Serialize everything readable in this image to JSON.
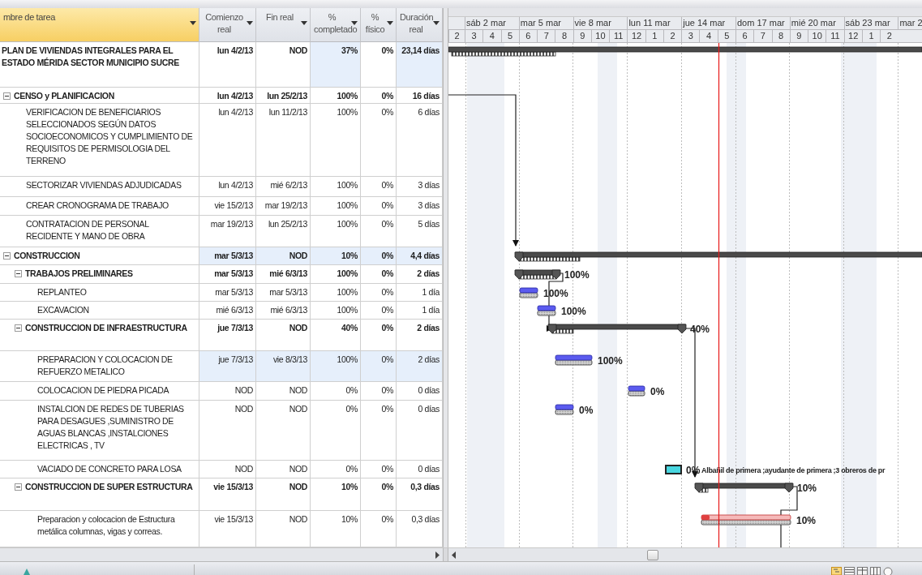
{
  "table": {
    "task_column": {
      "label": "mbre de tarea",
      "selected": true
    },
    "columns": [
      {
        "label": "Comienzo real",
        "selected": false
      },
      {
        "label": "Fin real",
        "selected": false
      },
      {
        "label": "% completado",
        "selected": false
      },
      {
        "label": "% físico",
        "selected": false
      },
      {
        "label": "Duración real",
        "selected": false
      }
    ],
    "rows": [
      {
        "name": "PLAN DE VIVIENDAS INTEGRALES PARA EL ESTADO MÉRIDA SECTOR MUNICIPIO SUCRE",
        "kind": "project",
        "cells": [
          {
            "text": "lun 4/2/13",
            "shaded": false
          },
          {
            "text": "NOD",
            "shaded": false
          },
          {
            "text": "37%",
            "shaded": true
          },
          {
            "text": "0%",
            "shaded": false
          },
          {
            "text": "23,14 días",
            "shaded": true
          }
        ],
        "bar": {
          "kind": "summary"
        },
        "children": [
          {
            "name": "CENSO y  PLANIFICACION",
            "kind": "summary",
            "expanded": true,
            "cells": [
              {
                "text": "lun 4/2/13",
                "shaded": false
              },
              {
                "text": "lun 25/2/13",
                "shaded": false
              },
              {
                "text": "100%",
                "shaded": false
              },
              {
                "text": "0%",
                "shaded": false
              },
              {
                "text": "16 días",
                "shaded": false
              }
            ],
            "children": [
              {
                "name": "VERIFICACION DE BENEFICIARIOS SELECCIONADOS SEGÚN DATOS SOCIOECONOMICOS Y CUMPLIMIENTO DE REQUISITOS DE PERMISOLOGIA DEL TERRENO",
                "kind": "task",
                "cells": [
                  {
                    "text": "lun 4/2/13",
                    "shaded": false
                  },
                  {
                    "text": "lun 11/2/13",
                    "shaded": false
                  },
                  {
                    "text": "100%",
                    "shaded": false
                  },
                  {
                    "text": "0%",
                    "shaded": false
                  },
                  {
                    "text": "6 días",
                    "shaded": false
                  }
                ]
              },
              {
                "name": "SECTORIZAR VIVIENDAS ADJUDICADAS",
                "kind": "task",
                "cells": [
                  {
                    "text": "lun 4/2/13",
                    "shaded": false
                  },
                  {
                    "text": "mié 6/2/13",
                    "shaded": false
                  },
                  {
                    "text": "100%",
                    "shaded": false
                  },
                  {
                    "text": "0%",
                    "shaded": false
                  },
                  {
                    "text": "3 días",
                    "shaded": false
                  }
                ]
              },
              {
                "name": "CREAR CRONOGRAMA DE TRABAJO",
                "kind": "task",
                "cells": [
                  {
                    "text": "vie 15/2/13",
                    "shaded": false
                  },
                  {
                    "text": "mar 19/2/13",
                    "shaded": false
                  },
                  {
                    "text": "100%",
                    "shaded": false
                  },
                  {
                    "text": "0%",
                    "shaded": false
                  },
                  {
                    "text": "3 días",
                    "shaded": false
                  }
                ]
              },
              {
                "name": "CONTRATACION DE PERSONAL RECIDENTE Y MANO DE OBRA",
                "kind": "task",
                "cells": [
                  {
                    "text": "mar 19/2/13",
                    "shaded": false
                  },
                  {
                    "text": "lun 25/2/13",
                    "shaded": false
                  },
                  {
                    "text": "100%",
                    "shaded": false
                  },
                  {
                    "text": "0%",
                    "shaded": false
                  },
                  {
                    "text": "5 días",
                    "shaded": false
                  }
                ]
              }
            ]
          },
          {
            "name": "CONSTRUCCION",
            "kind": "summary",
            "expanded": true,
            "cells": [
              {
                "text": "mar 5/3/13",
                "shaded": true
              },
              {
                "text": "NOD",
                "shaded": true
              },
              {
                "text": "10%",
                "shaded": true
              },
              {
                "text": "0%",
                "shaded": true
              },
              {
                "text": "4,4 días",
                "shaded": true
              }
            ],
            "bar": {
              "kind": "summary"
            },
            "children": [
              {
                "name": "TRABAJOS PRELIMINARES",
                "kind": "summary",
                "expanded": true,
                "cells": [
                  {
                    "text": "mar 5/3/13",
                    "shaded": false
                  },
                  {
                    "text": "mié 6/3/13",
                    "shaded": false
                  },
                  {
                    "text": "100%",
                    "shaded": false
                  },
                  {
                    "text": "0%",
                    "shaded": false
                  },
                  {
                    "text": "2 días",
                    "shaded": false
                  }
                ],
                "bar": {
                  "kind": "summary",
                  "label": "100%"
                },
                "children": [
                  {
                    "name": "REPLANTEO",
                    "kind": "task",
                    "cells": [
                      {
                        "text": "mar 5/3/13",
                        "shaded": false
                      },
                      {
                        "text": "mar 5/3/13",
                        "shaded": false
                      },
                      {
                        "text": "100%",
                        "shaded": false
                      },
                      {
                        "text": "0%",
                        "shaded": false
                      },
                      {
                        "text": "1 día",
                        "shaded": false
                      }
                    ],
                    "bar": {
                      "kind": "task",
                      "label": "100%"
                    }
                  },
                  {
                    "name": "EXCAVACION",
                    "kind": "task",
                    "cells": [
                      {
                        "text": "mié 6/3/13",
                        "shaded": false
                      },
                      {
                        "text": "mié 6/3/13",
                        "shaded": false
                      },
                      {
                        "text": "100%",
                        "shaded": false
                      },
                      {
                        "text": "0%",
                        "shaded": false
                      },
                      {
                        "text": "1 día",
                        "shaded": false
                      }
                    ],
                    "bar": {
                      "kind": "task",
                      "label": "100%"
                    }
                  }
                ]
              },
              {
                "name": "CONSTRUCCION DE INFRAESTRUCTURA",
                "kind": "summary",
                "expanded": true,
                "cells": [
                  {
                    "text": "jue 7/3/13",
                    "shaded": false
                  },
                  {
                    "text": "NOD",
                    "shaded": false
                  },
                  {
                    "text": "40%",
                    "shaded": false
                  },
                  {
                    "text": "0%",
                    "shaded": false
                  },
                  {
                    "text": "2 días",
                    "shaded": false
                  }
                ],
                "bar": {
                  "kind": "summary",
                  "label": "40%"
                },
                "children": [
                  {
                    "name": "PREPARACION Y COLOCACION DE REFUERZO METALICO",
                    "kind": "task",
                    "cells": [
                      {
                        "text": "jue 7/3/13",
                        "shaded": true
                      },
                      {
                        "text": "vie 8/3/13",
                        "shaded": true
                      },
                      {
                        "text": "100%",
                        "shaded": true
                      },
                      {
                        "text": "0%",
                        "shaded": true
                      },
                      {
                        "text": "2 días",
                        "shaded": true
                      }
                    ],
                    "bar": {
                      "kind": "task",
                      "label": "100%"
                    }
                  },
                  {
                    "name": "COLOCACION DE PIEDRA PICADA",
                    "kind": "task",
                    "cells": [
                      {
                        "text": "NOD",
                        "shaded": false
                      },
                      {
                        "text": "NOD",
                        "shaded": false
                      },
                      {
                        "text": "0%",
                        "shaded": false
                      },
                      {
                        "text": "0%",
                        "shaded": false
                      },
                      {
                        "text": "0 días",
                        "shaded": false
                      }
                    ],
                    "bar": {
                      "kind": "task",
                      "label": "0%"
                    }
                  },
                  {
                    "name": "INSTALCION DE REDES DE TUBERIAS PARA DESAGUES ,SUMINISTRO DE AGUAS BLANCAS ,INSTALCIONES ELECTRICAS , TV",
                    "kind": "task",
                    "cells": [
                      {
                        "text": "NOD",
                        "shaded": false
                      },
                      {
                        "text": "NOD",
                        "shaded": false
                      },
                      {
                        "text": "0%",
                        "shaded": false
                      },
                      {
                        "text": "0%",
                        "shaded": false
                      },
                      {
                        "text": "0 días",
                        "shaded": false
                      }
                    ],
                    "bar": {
                      "kind": "task",
                      "label": "0%"
                    }
                  },
                  {
                    "name": "VACIADO DE CONCRETO PARA LOSA",
                    "kind": "task",
                    "cells": [
                      {
                        "text": "NOD",
                        "shaded": false
                      },
                      {
                        "text": "NOD",
                        "shaded": false
                      },
                      {
                        "text": "0%",
                        "shaded": false
                      },
                      {
                        "text": "0%",
                        "shaded": false
                      },
                      {
                        "text": "0 días",
                        "shaded": false
                      }
                    ],
                    "bar": {
                      "kind": "manual",
                      "label": "0%",
                      "resources": "Albañil de primera ;ayudante de primera ;3 obreros de pr"
                    }
                  }
                ]
              },
              {
                "name": "CONSTRUCCION DE SUPER ESTRUCTURA",
                "kind": "summary",
                "expanded": true,
                "cells": [
                  {
                    "text": "vie 15/3/13",
                    "shaded": false
                  },
                  {
                    "text": "NOD",
                    "shaded": false
                  },
                  {
                    "text": "10%",
                    "shaded": false
                  },
                  {
                    "text": "0%",
                    "shaded": false
                  },
                  {
                    "text": "0,3 días",
                    "shaded": false
                  }
                ],
                "bar": {
                  "kind": "summary",
                  "label": "10%"
                },
                "children": [
                  {
                    "name": "Preparacion y colocacion de Estructura metálica columnas, vigas y correas.",
                    "kind": "task",
                    "cells": [
                      {
                        "text": "vie 15/3/13",
                        "shaded": false
                      },
                      {
                        "text": "NOD",
                        "shaded": false
                      },
                      {
                        "text": "10%",
                        "shaded": false
                      },
                      {
                        "text": "0%",
                        "shaded": false
                      },
                      {
                        "text": "0,3 días",
                        "shaded": false
                      }
                    ],
                    "bar": {
                      "kind": "critical",
                      "label": "10%"
                    }
                  }
                ]
              }
            ]
          }
        ]
      }
    ]
  },
  "gantt": {
    "timescale": {
      "major": [
        "sáb 2 mar",
        "mar 5 mar",
        "vie 8 mar",
        "lun 11 mar",
        "jue 14 mar",
        "dom 17 mar",
        "mié 20 mar",
        "sáb 23 mar",
        "mar 2"
      ],
      "minor": [
        "2",
        "3",
        "4",
        "5",
        "6",
        "7",
        "8",
        "9",
        "10",
        "11",
        "12",
        "1",
        "2",
        "3",
        "4",
        "5",
        "6",
        "7",
        "8",
        "9",
        "10",
        "11",
        "12",
        "1",
        "2"
      ]
    }
  }
}
